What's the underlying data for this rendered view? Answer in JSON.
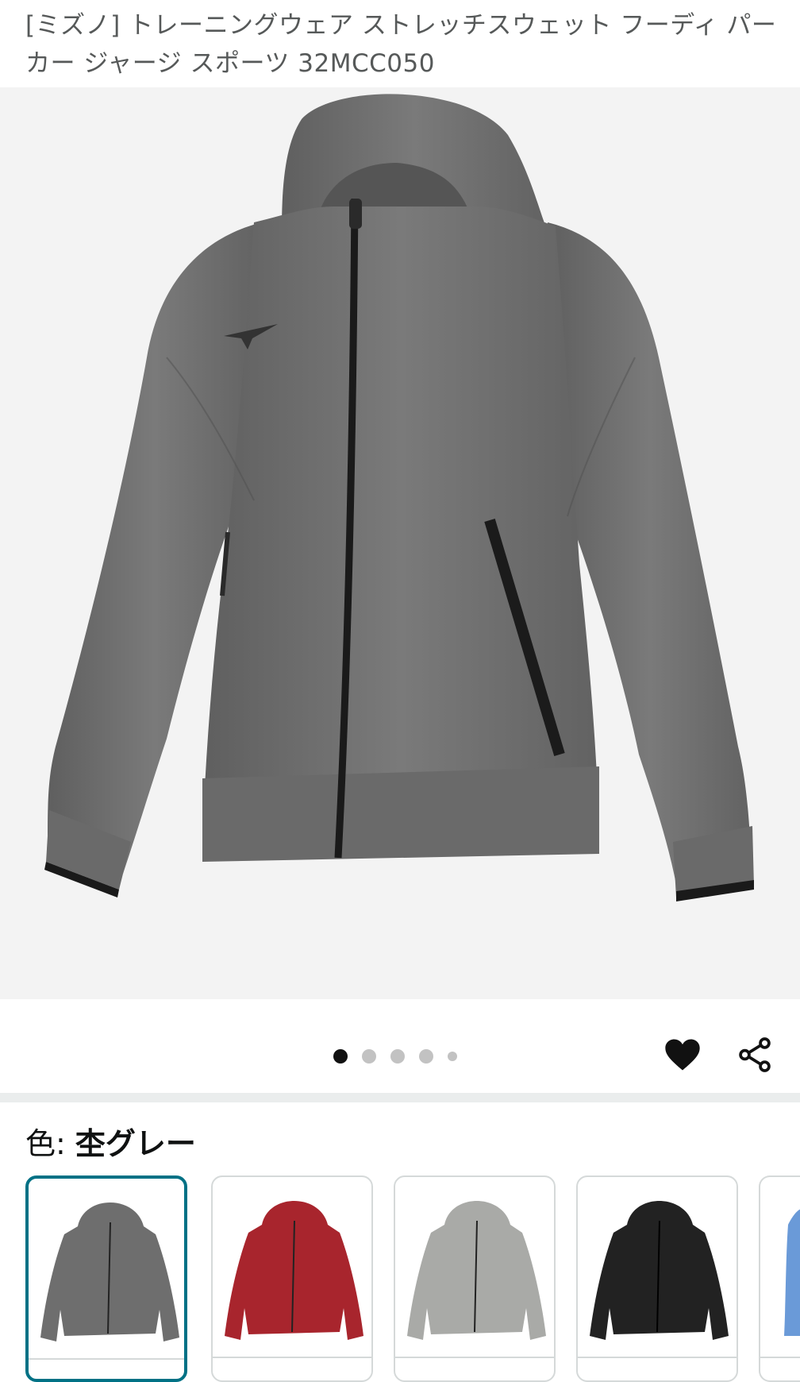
{
  "product": {
    "title": "[ミズノ] トレーニングウェア ストレッチスウェット フーディ パーカー ジャージ スポーツ 32MCC050"
  },
  "gallery": {
    "image_count": 5,
    "current_index": 0,
    "main_image": "gray-hoodie-photo",
    "actions": [
      "heart-icon",
      "share-icon"
    ]
  },
  "colors": {
    "label": "色: ",
    "selected": "杢グレー",
    "swatches": [
      {
        "name": "gray",
        "hex": "#6e6e6e",
        "selected": true
      },
      {
        "name": "red",
        "hex": "#a8252d",
        "selected": false
      },
      {
        "name": "light-gray",
        "hex": "#a9aaa7",
        "selected": false
      },
      {
        "name": "black",
        "hex": "#222222",
        "selected": false
      },
      {
        "name": "blue",
        "hex": "#6a9ad8",
        "selected": false
      }
    ]
  },
  "theme": {
    "accent": "#007185",
    "dot_active": "#111111",
    "dot_inactive": "#c2c2c2"
  }
}
